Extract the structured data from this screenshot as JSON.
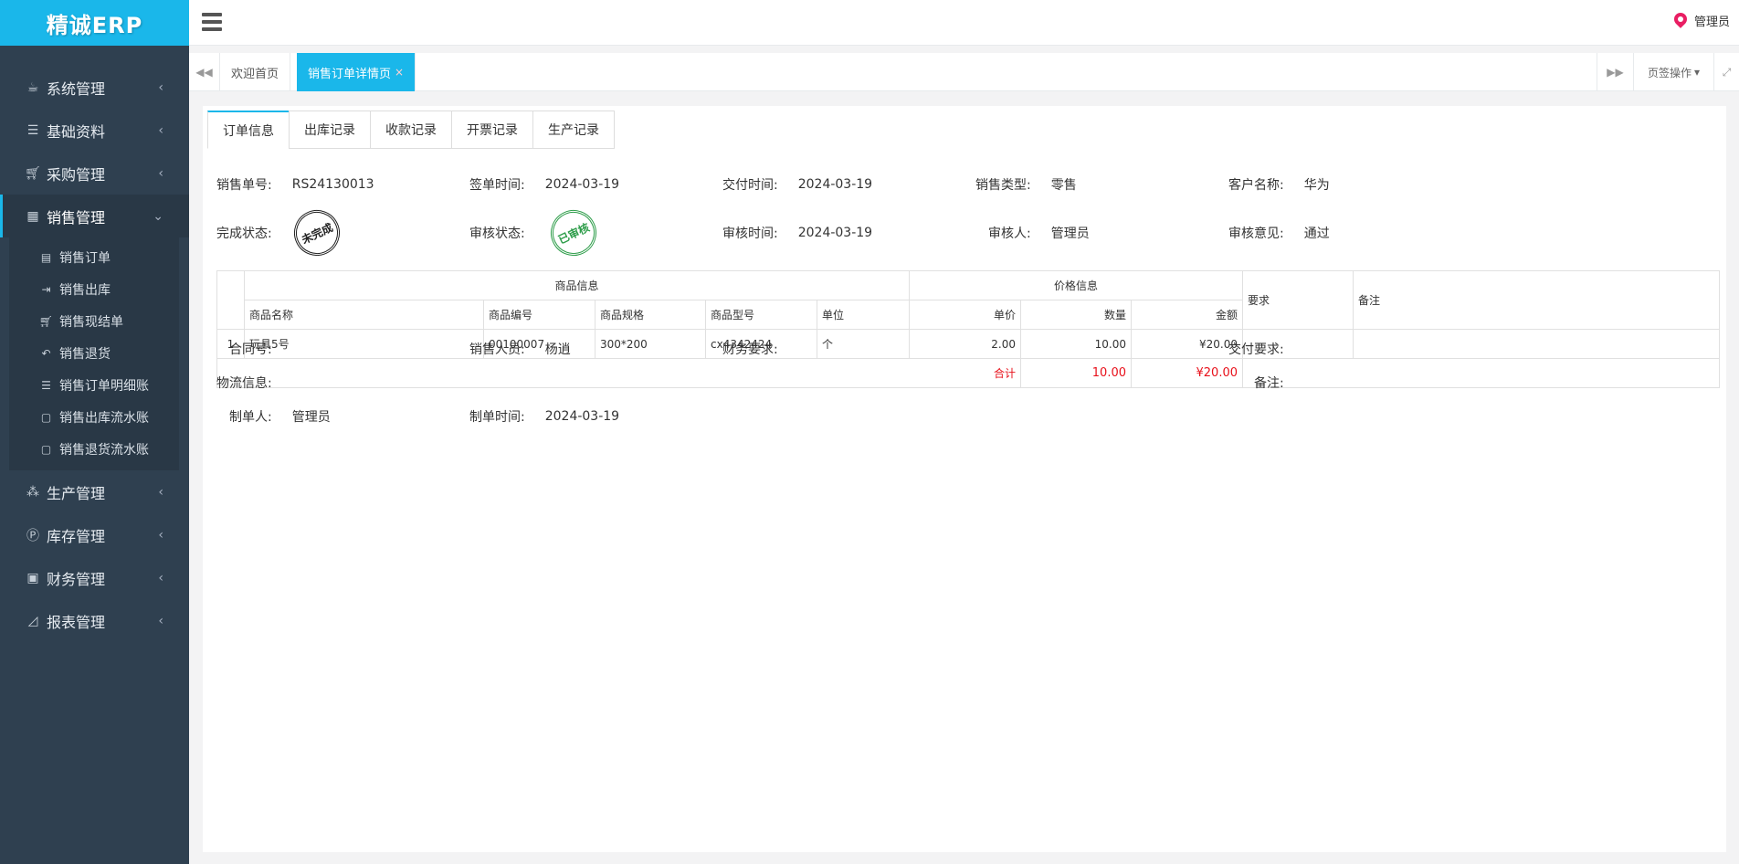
{
  "brand": "精诚ERP",
  "user": {
    "name": "管理员"
  },
  "sidebar": {
    "items": [
      {
        "label": "系统管理",
        "icon": "coffee-icon"
      },
      {
        "label": "基础资料",
        "icon": "list-icon"
      },
      {
        "label": "采购管理",
        "icon": "cart-icon"
      },
      {
        "label": "销售管理",
        "icon": "building-icon"
      },
      {
        "label": "生产管理",
        "icon": "cubes-icon"
      },
      {
        "label": "库存管理",
        "icon": "parking-icon"
      },
      {
        "label": "财务管理",
        "icon": "money-icon"
      },
      {
        "label": "报表管理",
        "icon": "area-chart-icon"
      }
    ],
    "sales_sub": [
      {
        "label": "销售订单",
        "icon": "file-icon"
      },
      {
        "label": "销售出库",
        "icon": "sign-out-icon"
      },
      {
        "label": "销售现结单",
        "icon": "cart-icon"
      },
      {
        "label": "销售退货",
        "icon": "reply-icon"
      },
      {
        "label": "销售订单明细账",
        "icon": "list-icon"
      },
      {
        "label": "销售出库流水账",
        "icon": "file-text-icon"
      },
      {
        "label": "销售退货流水账",
        "icon": "file-text-icon"
      }
    ]
  },
  "tabs": {
    "home": "欢迎首页",
    "current": "销售订单详情页",
    "close": "×",
    "page_ops": "页签操作"
  },
  "inner_tabs": [
    "订单信息",
    "出库记录",
    "收款记录",
    "开票记录",
    "生产记录"
  ],
  "order": {
    "no_label": "销售单号:",
    "no": "RS24130013",
    "sign_label": "签单时间:",
    "sign_date": "2024-03-19",
    "delivery_label": "交付时间:",
    "delivery_date": "2024-03-19",
    "type_label": "销售类型:",
    "type": "零售",
    "customer_label": "客户名称:",
    "customer": "华为",
    "finish_label": "完成状态:",
    "finish_stamp": "未完成",
    "audit_status_label": "审核状态:",
    "audit_stamp": "已审核",
    "audit_time_label": "审核时间:",
    "audit_time": "2024-03-19",
    "auditor_label": "审核人:",
    "auditor": "管理员",
    "opinion_label": "审核意见:",
    "opinion": "通过"
  },
  "table": {
    "group_product": "商品信息",
    "group_price": "价格信息",
    "col_req": "要求",
    "col_remark": "备注",
    "cols": [
      "商品名称",
      "商品编号",
      "商品规格",
      "商品型号",
      "单位",
      "单价",
      "数量",
      "金额"
    ],
    "rows": [
      {
        "idx": "1",
        "name": "玩具5号",
        "code": "00100007",
        "spec": "300*200",
        "model": "cx4342424",
        "unit": "个",
        "price": "2.00",
        "qty": "10.00",
        "amount": "¥20.00",
        "req": "",
        "remark": ""
      }
    ],
    "total_label": "合计",
    "total_qty": "10.00",
    "total_amount": "¥20.00"
  },
  "footer": {
    "contract_label": "合同号:",
    "contract": "",
    "salesman_label": "销售人员:",
    "salesman": "杨逍",
    "finance_label": "财务要求:",
    "finance": "",
    "delivery_req_label": "交付要求:",
    "delivery_req": "",
    "logistics_label": "物流信息:",
    "logistics": "",
    "remark_label": "备注:",
    "remark": "",
    "maker_label": "制单人:",
    "maker": "管理员",
    "make_time_label": "制单时间:",
    "make_time": "2024-03-19"
  }
}
